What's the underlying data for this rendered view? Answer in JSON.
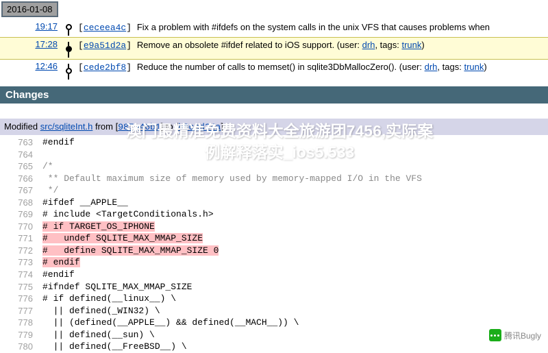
{
  "date_badge": "2016-01-08",
  "timeline": [
    {
      "time": "19:17",
      "hash": "ceceea4c",
      "msg": "Fix a problem with #ifdefs on the system calls in the unix VFS that causes problems when"
    },
    {
      "time": "17:28",
      "hash": "e9a51d2a",
      "msg": "Remove an obsolete #ifdef related to iOS support.",
      "user": "drh",
      "tags": "trunk",
      "highlight": true
    },
    {
      "time": "12:46",
      "hash": "cede2bf8",
      "msg": "Reduce the number of calls to memset() in sqlite3DbMallocZero().",
      "user": "drh",
      "tags": "trunk"
    }
  ],
  "changes_header": "Changes",
  "modified": {
    "pre": "Modified ",
    "file": "src/sqliteInt.h",
    "mid": " from ",
    "from": "987b46b1",
    "mid2": " to ",
    "to": "b8ccd34a",
    "end": "."
  },
  "code": [
    {
      "ln": 763,
      "t": "#endif"
    },
    {
      "ln": 764,
      "t": ""
    },
    {
      "ln": 765,
      "t": "/*",
      "cls": "comment"
    },
    {
      "ln": 766,
      "t": " ** Default maximum size of memory used by memory-mapped I/O in the VFS",
      "cls": "comment"
    },
    {
      "ln": 767,
      "t": " */",
      "cls": "comment"
    },
    {
      "ln": 768,
      "t": "#ifdef __APPLE__"
    },
    {
      "ln": 769,
      "t": "# include <TargetConditionals.h>"
    },
    {
      "ln": 770,
      "t": "# if TARGET_OS_IPHONE",
      "cls": "del"
    },
    {
      "ln": 771,
      "t": "#   undef SQLITE_MAX_MMAP_SIZE",
      "cls": "del"
    },
    {
      "ln": 772,
      "t": "#   define SQLITE_MAX_MMAP_SIZE 0",
      "cls": "del"
    },
    {
      "ln": 773,
      "t": "# endif",
      "cls": "del"
    },
    {
      "ln": 774,
      "t": "#endif"
    },
    {
      "ln": 775,
      "t": "#ifndef SQLITE_MAX_MMAP_SIZE"
    },
    {
      "ln": 776,
      "t": "# if defined(__linux__) \\"
    },
    {
      "ln": 777,
      "t": "  || defined(_WIN32) \\"
    },
    {
      "ln": 778,
      "t": "  || (defined(__APPLE__) && defined(__MACH__)) \\"
    },
    {
      "ln": 779,
      "t": "  || defined(__sun) \\"
    },
    {
      "ln": 780,
      "t": "  || defined(__FreeBSD__) \\"
    }
  ],
  "overlay": {
    "line1": "澳门最精准免费资料大全旅游团7456,实际案",
    "line2": "例解释落实_ios5.533"
  },
  "watermark": "腾讯Bugly"
}
